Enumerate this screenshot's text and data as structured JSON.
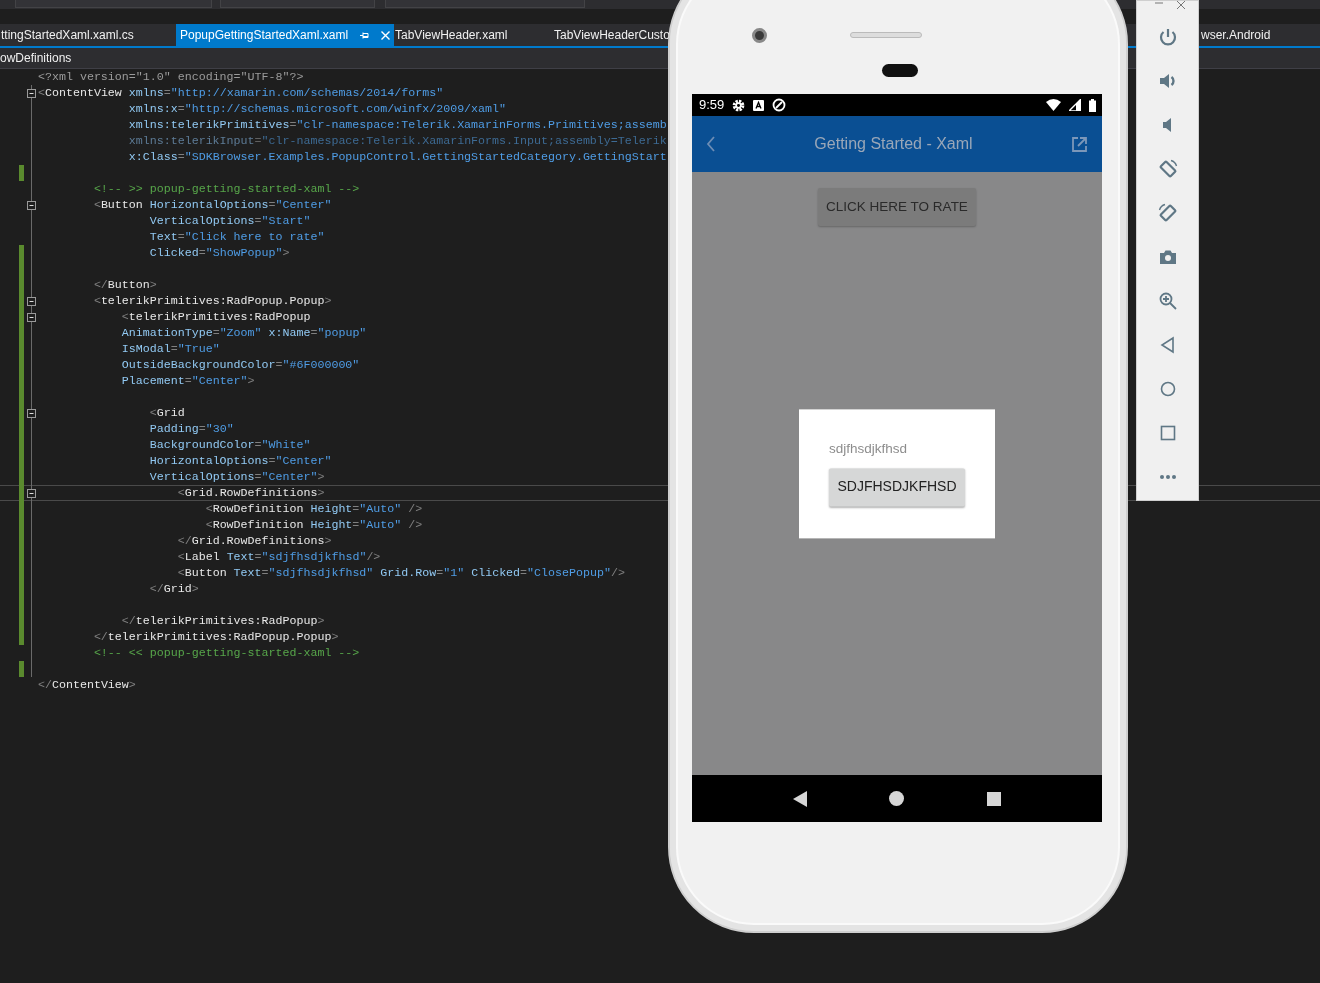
{
  "ide": {
    "document_tabs": [
      {
        "label": "ttingStartedXaml.xaml.cs",
        "selected": false
      },
      {
        "label": "PopupGettingStartedXaml.xaml",
        "selected": true
      },
      {
        "label": "TabViewHeader.xaml",
        "selected": false
      },
      {
        "label": "TabViewHeaderCusto",
        "selected": false
      },
      {
        "label": "wser.Android",
        "selected": false
      }
    ],
    "breadcrumb": "owDefinitions",
    "editor": {
      "lines": [
        {
          "segments": [
            {
              "kind": "decl",
              "text": "<?xml version=\"1.0\" encoding=\"UTF-8\"?>"
            }
          ],
          "foldable": false,
          "changed": false,
          "current": false,
          "dimmed": false
        },
        {
          "segments": [
            {
              "kind": "punct",
              "text": "<"
            },
            {
              "kind": "tag",
              "text": "ContentView"
            },
            {
              "kind": "attr",
              "text": " xmlns"
            },
            {
              "kind": "punct",
              "text": "="
            },
            {
              "kind": "value",
              "text": "\"http://xamarin.com/schemas/2014/forms\""
            }
          ],
          "foldable": true,
          "changed": false,
          "current": false,
          "dimmed": false
        },
        {
          "segments": [
            {
              "kind": "attr",
              "text": "             xmlns:x"
            },
            {
              "kind": "punct",
              "text": "="
            },
            {
              "kind": "value",
              "text": "\"http://schemas.microsoft.com/winfx/2009/xaml\""
            }
          ],
          "foldable": false,
          "changed": false,
          "current": false,
          "dimmed": false
        },
        {
          "segments": [
            {
              "kind": "attr",
              "text": "             xmlns:telerikPrimitives"
            },
            {
              "kind": "punct",
              "text": "="
            },
            {
              "kind": "value",
              "text": "\"clr-namespace:Telerik.XamarinForms.Primitives;assemb"
            }
          ],
          "foldable": false,
          "changed": false,
          "current": false,
          "dimmed": false
        },
        {
          "segments": [
            {
              "kind": "attr",
              "text": "             xmlns:telerikInput"
            },
            {
              "kind": "punct",
              "text": "="
            },
            {
              "kind": "value",
              "text": "\"clr-namespace:Telerik.XamarinForms.Input;assembly=Telerik"
            }
          ],
          "foldable": false,
          "changed": false,
          "current": false,
          "dimmed": true
        },
        {
          "segments": [
            {
              "kind": "attr",
              "text": "             x:Class"
            },
            {
              "kind": "punct",
              "text": "="
            },
            {
              "kind": "value",
              "text": "\"SDKBrowser.Examples.PopupControl.GettingStartedCategory.GettingStart"
            }
          ],
          "foldable": false,
          "changed": false,
          "current": false,
          "dimmed": false
        },
        {
          "foldable": false,
          "changed": true,
          "current": false
        },
        {
          "segments": [
            {
              "kind": "comment",
              "text": "        <!-- >> popup-getting-started-xaml -->"
            }
          ],
          "foldable": false,
          "changed": false,
          "current": false,
          "dimmed": false
        },
        {
          "segments": [
            {
              "kind": "punct",
              "text": "        <"
            },
            {
              "kind": "tag",
              "text": "Button"
            },
            {
              "kind": "attr",
              "text": " HorizontalOptions"
            },
            {
              "kind": "punct",
              "text": "="
            },
            {
              "kind": "value",
              "text": "\"Center\""
            }
          ],
          "foldable": true,
          "changed": false,
          "current": false,
          "dimmed": false
        },
        {
          "segments": [
            {
              "kind": "attr",
              "text": "                VerticalOptions"
            },
            {
              "kind": "punct",
              "text": "="
            },
            {
              "kind": "value",
              "text": "\"Start\""
            }
          ],
          "foldable": false,
          "changed": false,
          "current": false,
          "dimmed": false
        },
        {
          "segments": [
            {
              "kind": "attr",
              "text": "                Text"
            },
            {
              "kind": "punct",
              "text": "="
            },
            {
              "kind": "value",
              "text": "\"Click here to rate\""
            }
          ],
          "foldable": false,
          "changed": false,
          "current": false,
          "dimmed": false
        },
        {
          "segments": [
            {
              "kind": "attr",
              "text": "                Clicked"
            },
            {
              "kind": "punct",
              "text": "="
            },
            {
              "kind": "value",
              "text": "\"ShowPopup\""
            },
            {
              "kind": "punct",
              "text": ">"
            }
          ],
          "foldable": false,
          "changed": true,
          "current": false,
          "dimmed": false
        },
        {
          "foldable": false,
          "changed": true,
          "current": false
        },
        {
          "segments": [
            {
              "kind": "punct",
              "text": "        </"
            },
            {
              "kind": "tag",
              "text": "Button"
            },
            {
              "kind": "punct",
              "text": ">"
            }
          ],
          "foldable": false,
          "changed": true,
          "current": false,
          "dimmed": false
        },
        {
          "segments": [
            {
              "kind": "punct",
              "text": "        <"
            },
            {
              "kind": "tag",
              "text": "telerikPrimitives:RadPopup.Popup"
            },
            {
              "kind": "punct",
              "text": ">"
            }
          ],
          "foldable": true,
          "changed": true,
          "current": false,
          "dimmed": false
        },
        {
          "segments": [
            {
              "kind": "punct",
              "text": "            <"
            },
            {
              "kind": "tag",
              "text": "telerikPrimitives:RadPopup"
            }
          ],
          "foldable": true,
          "changed": true,
          "current": false,
          "dimmed": false
        },
        {
          "segments": [
            {
              "kind": "attr",
              "text": "            AnimationType"
            },
            {
              "kind": "punct",
              "text": "="
            },
            {
              "kind": "value",
              "text": "\"Zoom\""
            },
            {
              "kind": "attr",
              "text": " x:Name"
            },
            {
              "kind": "punct",
              "text": "="
            },
            {
              "kind": "value",
              "text": "\"popup\""
            }
          ],
          "foldable": false,
          "changed": true,
          "current": false,
          "dimmed": false
        },
        {
          "segments": [
            {
              "kind": "attr",
              "text": "            IsModal"
            },
            {
              "kind": "punct",
              "text": "="
            },
            {
              "kind": "value",
              "text": "\"True\""
            }
          ],
          "foldable": false,
          "changed": true,
          "current": false,
          "dimmed": false
        },
        {
          "segments": [
            {
              "kind": "attr",
              "text": "            OutsideBackgroundColor"
            },
            {
              "kind": "punct",
              "text": "="
            },
            {
              "kind": "value",
              "text": "\"#6F000000\""
            }
          ],
          "foldable": false,
          "changed": true,
          "current": false,
          "dimmed": false
        },
        {
          "segments": [
            {
              "kind": "attr",
              "text": "            Placement"
            },
            {
              "kind": "punct",
              "text": "="
            },
            {
              "kind": "value",
              "text": "\"Center\""
            },
            {
              "kind": "punct",
              "text": ">"
            }
          ],
          "foldable": false,
          "changed": true,
          "current": false,
          "dimmed": false
        },
        {
          "foldable": false,
          "changed": true,
          "current": false
        },
        {
          "segments": [
            {
              "kind": "punct",
              "text": "                <"
            },
            {
              "kind": "tag",
              "text": "Grid"
            }
          ],
          "foldable": true,
          "changed": true,
          "current": false,
          "dimmed": false
        },
        {
          "segments": [
            {
              "kind": "attr",
              "text": "                Padding"
            },
            {
              "kind": "punct",
              "text": "="
            },
            {
              "kind": "value",
              "text": "\"30\""
            }
          ],
          "foldable": false,
          "changed": true,
          "current": false,
          "dimmed": false
        },
        {
          "segments": [
            {
              "kind": "attr",
              "text": "                BackgroundColor"
            },
            {
              "kind": "punct",
              "text": "="
            },
            {
              "kind": "value",
              "text": "\"White\""
            }
          ],
          "foldable": false,
          "changed": true,
          "current": false,
          "dimmed": false
        },
        {
          "segments": [
            {
              "kind": "attr",
              "text": "                HorizontalOptions"
            },
            {
              "kind": "punct",
              "text": "="
            },
            {
              "kind": "value",
              "text": "\"Center\""
            }
          ],
          "foldable": false,
          "changed": true,
          "current": false,
          "dimmed": false
        },
        {
          "segments": [
            {
              "kind": "attr",
              "text": "                VerticalOptions"
            },
            {
              "kind": "punct",
              "text": "="
            },
            {
              "kind": "value",
              "text": "\"Center\""
            },
            {
              "kind": "punct",
              "text": ">"
            }
          ],
          "foldable": false,
          "changed": true,
          "current": false,
          "dimmed": false
        },
        {
          "segments": [
            {
              "kind": "punct",
              "text": "                    <"
            },
            {
              "kind": "tag",
              "text": "Grid.RowDefinitions"
            },
            {
              "kind": "punct",
              "text": ">"
            }
          ],
          "foldable": true,
          "changed": true,
          "current": true,
          "dimmed": false
        },
        {
          "segments": [
            {
              "kind": "punct",
              "text": "                        <"
            },
            {
              "kind": "tag",
              "text": "RowDefinition"
            },
            {
              "kind": "attr",
              "text": " Height"
            },
            {
              "kind": "punct",
              "text": "="
            },
            {
              "kind": "value",
              "text": "\"Auto\""
            },
            {
              "kind": "punct",
              "text": " />"
            }
          ],
          "foldable": false,
          "changed": true,
          "current": false,
          "dimmed": false
        },
        {
          "segments": [
            {
              "kind": "punct",
              "text": "                        <"
            },
            {
              "kind": "tag",
              "text": "RowDefinition"
            },
            {
              "kind": "attr",
              "text": " Height"
            },
            {
              "kind": "punct",
              "text": "="
            },
            {
              "kind": "value",
              "text": "\"Auto\""
            },
            {
              "kind": "punct",
              "text": " />"
            }
          ],
          "foldable": false,
          "changed": true,
          "current": false,
          "dimmed": false
        },
        {
          "segments": [
            {
              "kind": "punct",
              "text": "                    </"
            },
            {
              "kind": "tag",
              "text": "Grid.RowDefinitions"
            },
            {
              "kind": "punct",
              "text": ">"
            }
          ],
          "foldable": false,
          "changed": true,
          "current": false,
          "dimmed": false
        },
        {
          "segments": [
            {
              "kind": "punct",
              "text": "                    <"
            },
            {
              "kind": "tag",
              "text": "Label"
            },
            {
              "kind": "attr",
              "text": " Text"
            },
            {
              "kind": "punct",
              "text": "="
            },
            {
              "kind": "value",
              "text": "\"sdjfhsdjkfhsd\""
            },
            {
              "kind": "punct",
              "text": "/>"
            }
          ],
          "foldable": false,
          "changed": true,
          "current": false,
          "dimmed": false
        },
        {
          "segments": [
            {
              "kind": "punct",
              "text": "                    <"
            },
            {
              "kind": "tag",
              "text": "Button"
            },
            {
              "kind": "attr",
              "text": " Text"
            },
            {
              "kind": "punct",
              "text": "="
            },
            {
              "kind": "value",
              "text": "\"sdjfhsdjkfhsd\""
            },
            {
              "kind": "attr",
              "text": " Grid.Row"
            },
            {
              "kind": "punct",
              "text": "="
            },
            {
              "kind": "value",
              "text": "\"1\""
            },
            {
              "kind": "attr",
              "text": " Clicked"
            },
            {
              "kind": "punct",
              "text": "="
            },
            {
              "kind": "value",
              "text": "\"ClosePopup\""
            },
            {
              "kind": "punct",
              "text": "/>"
            }
          ],
          "foldable": false,
          "changed": true,
          "current": false,
          "dimmed": false
        },
        {
          "segments": [
            {
              "kind": "punct",
              "text": "                </"
            },
            {
              "kind": "tag",
              "text": "Grid"
            },
            {
              "kind": "punct",
              "text": ">"
            }
          ],
          "foldable": false,
          "changed": true,
          "current": false,
          "dimmed": false
        },
        {
          "foldable": false,
          "changed": true,
          "current": false
        },
        {
          "segments": [
            {
              "kind": "punct",
              "text": "            </"
            },
            {
              "kind": "tag",
              "text": "telerikPrimitives:RadPopup"
            },
            {
              "kind": "punct",
              "text": ">"
            }
          ],
          "foldable": false,
          "changed": true,
          "current": false,
          "dimmed": false
        },
        {
          "segments": [
            {
              "kind": "punct",
              "text": "        </"
            },
            {
              "kind": "tag",
              "text": "telerikPrimitives:RadPopup.Popup"
            },
            {
              "kind": "punct",
              "text": ">"
            }
          ],
          "foldable": false,
          "changed": true,
          "current": false,
          "dimmed": false
        },
        {
          "segments": [
            {
              "kind": "comment",
              "text": "        <!-- << popup-getting-started-xaml -->"
            }
          ],
          "foldable": false,
          "changed": false,
          "current": false,
          "dimmed": false
        },
        {
          "foldable": false,
          "changed": true,
          "current": false
        },
        {
          "segments": [
            {
              "kind": "punct",
              "text": "</"
            },
            {
              "kind": "tag",
              "text": "ContentView"
            },
            {
              "kind": "punct",
              "text": ">"
            }
          ],
          "foldable": false,
          "changed": false,
          "current": false,
          "dimmed": false
        }
      ]
    }
  },
  "emulator": {
    "status_bar": {
      "time": "9:59"
    },
    "app_bar": {
      "title": "Getting Started - Xaml"
    },
    "page": {
      "rate_button": "CLICK HERE TO RATE"
    },
    "popup": {
      "label": "sdjfhsdjkfhsd",
      "button": "SDJFHSDJKFHSD"
    }
  }
}
